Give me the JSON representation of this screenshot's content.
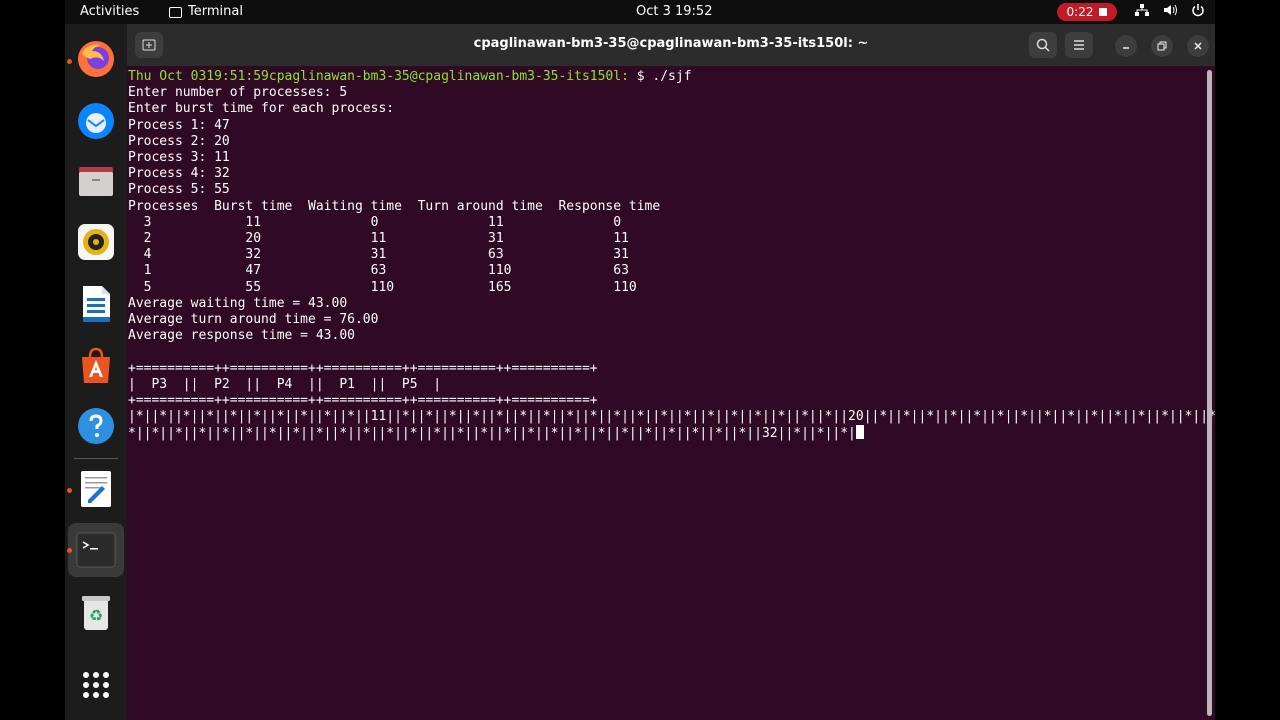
{
  "topbar": {
    "activities": "Activities",
    "app_name": "Terminal",
    "clock": "Oct 3  19:52",
    "recording_time": "0:22",
    "icons": [
      "network-icon",
      "volume-icon",
      "power-icon"
    ]
  },
  "dock": {
    "items": [
      "firefox-icon",
      "thunderbird-icon",
      "files-icon",
      "rhythmbox-icon",
      "libreoffice-writer-icon",
      "app-center-icon",
      "help-icon",
      "text-editor-icon",
      "terminal-icon",
      "trash-icon",
      "show-apps-icon"
    ]
  },
  "window": {
    "title": "cpaglinawan-bm3-35@cpaglinawan-bm3-35-its150l: ~"
  },
  "terminal": {
    "prompt": "Thu Oct 0319:51:59cpaglinawan-bm3-35@cpaglinawan-bm3-35-its150l:",
    "command": "$ ./sjf",
    "lines": [
      "Enter number of processes: 5",
      "Enter burst time for each process:",
      "Process 1: 47",
      "Process 2: 20",
      "Process 3: 11",
      "Process 4: 32",
      "Process 5: 55",
      "Processes  Burst time  Waiting time  Turn around time  Response time",
      "  3            11              0              11              0",
      "  2            20              11             31              11",
      "  4            32              31             63              31",
      "  1            47              63             110             63",
      "  5            55              110            165             110",
      "Average waiting time = 43.00",
      "Average turn around time = 76.00",
      "Average response time = 43.00",
      "",
      "+==========++==========++==========++==========++==========+",
      "|  P3  ||  P2  ||  P4  ||  P1  ||  P5  |",
      "+==========++==========++==========++==========++==========+",
      "|*||*||*||*||*||*||*||*||*||*||11||*||*||*||*||*||*||*||*||*||*||*||*||*||*||*||*||*||*||*||20||*||*||*||*||*||*||*||*||*||*||*||*||*||*||*||*||*||",
      "*||*||*||*||*||*||*||*||*||*||*||*||*||*||*||*||*||*||*||*||*||*||*||*||*||*||*||32||*||*||*|"
    ]
  }
}
